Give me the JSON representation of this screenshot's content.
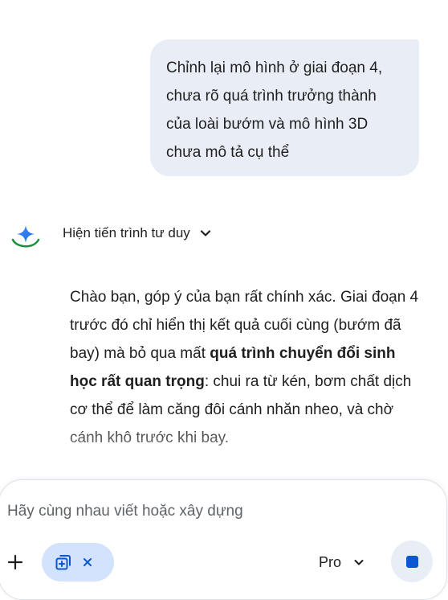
{
  "user_message": {
    "text": "Chỉnh lại mô hình ở giai đoạn 4,\nchưa rõ quá trình trưởng thành\ncủa loài bướm và mô hình 3D\nchưa mô tả cụ thể"
  },
  "assistant": {
    "thinking_toggle_label": "Hiện tiến trình tư duy",
    "response": {
      "part1": "Chào bạn, góp ý của bạn rất chính xác. Giai đoạn 4 trước đó chỉ hiển thị kết quả cuối cùng (bướm đã bay) mà bỏ qua mất ",
      "bold": "quá trình chuyển đổi sinh học rất quan trọng",
      "part2": ": chui ra từ kén, bơm chất dịch cơ thể để làm căng đôi cánh nhăn nheo, và chờ cánh khô trước khi bay."
    }
  },
  "composer": {
    "placeholder": "Hãy cùng nhau viết hoặc xây dựng",
    "model_label": "Pro"
  },
  "colors": {
    "user_bubble": "#e9eef6",
    "tool_chip": "#d3e3fd",
    "accent_blue": "#0b57d0",
    "logo_green": "#1e8e3e"
  },
  "icons": {
    "assistant_logo": "sparkle-logo-icon",
    "chevron": "chevron-down-icon",
    "add": "plus-icon",
    "canvas_tool": "canvas-add-icon",
    "remove": "close-icon",
    "stop": "stop-icon"
  }
}
